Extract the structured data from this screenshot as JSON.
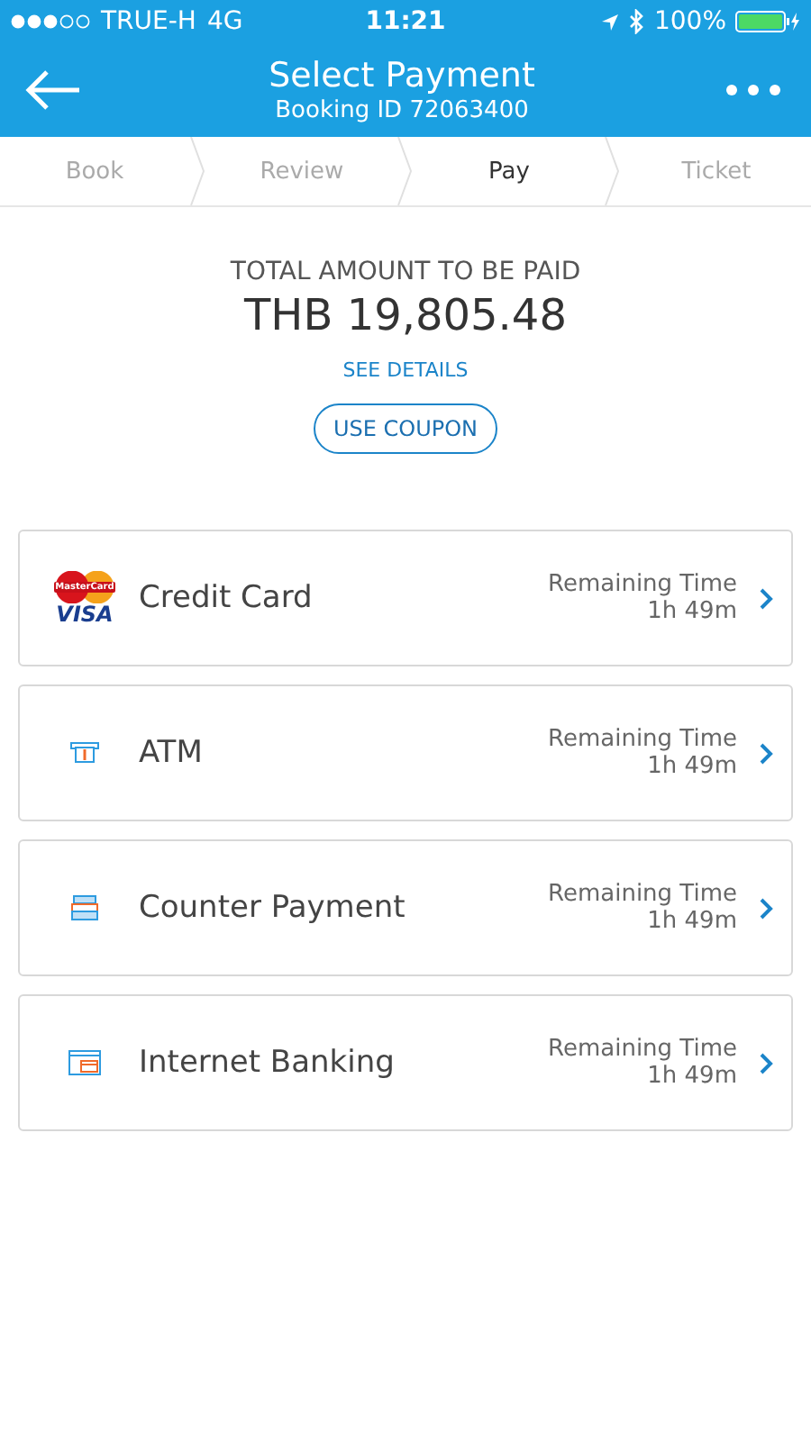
{
  "status_bar": {
    "carrier": "TRUE-H",
    "network": "4G",
    "time": "11:21",
    "battery": "100%"
  },
  "header": {
    "title": "Select Payment",
    "subtitle": "Booking ID 72063400"
  },
  "steps": [
    {
      "label": "Book",
      "selected": false
    },
    {
      "label": "Review",
      "selected": false
    },
    {
      "label": "Pay",
      "selected": true
    },
    {
      "label": "Ticket",
      "selected": false
    }
  ],
  "total": {
    "label": "TOTAL AMOUNT TO BE PAID",
    "amount": "THB 19,805.48",
    "details_link": "SEE DETAILS",
    "coupon_button": "USE COUPON"
  },
  "payment_methods": [
    {
      "kind": "card",
      "name": "Credit Card",
      "logo_texts": [
        "MasterCard",
        "VISA"
      ],
      "remaining_label": "Remaining Time",
      "remaining": "1h 49m"
    },
    {
      "kind": "atm",
      "name": "ATM",
      "remaining_label": "Remaining Time",
      "remaining": "1h 49m"
    },
    {
      "kind": "counter",
      "name": "Counter Payment",
      "remaining_label": "Remaining Time",
      "remaining": "1h 49m"
    },
    {
      "kind": "banking",
      "name": "Internet Banking",
      "remaining_label": "Remaining Time",
      "remaining": "1h 49m"
    }
  ]
}
